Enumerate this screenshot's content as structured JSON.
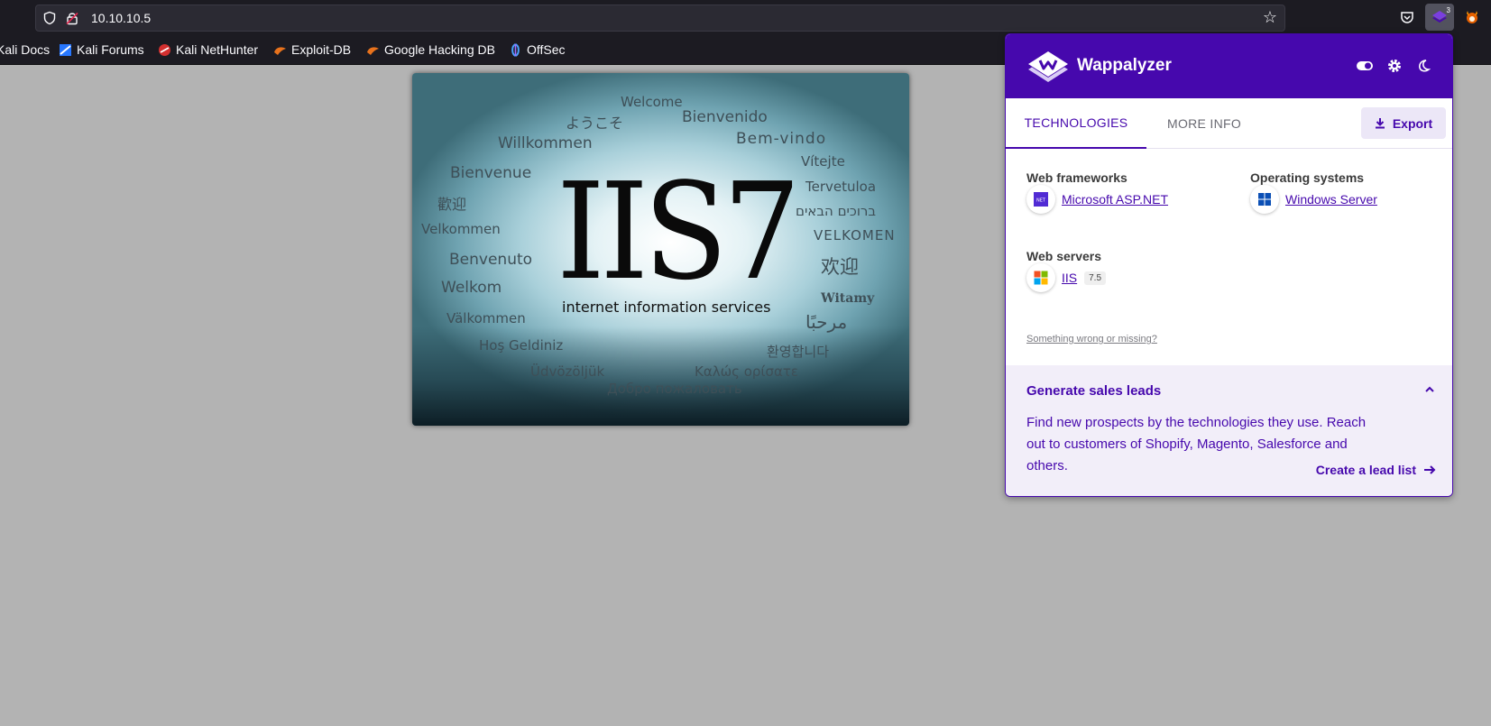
{
  "browser": {
    "url": "10.10.10.5",
    "extension_badge": "3",
    "bookmarks": [
      {
        "label": "Kali Docs",
        "icon": "kali-dragon-icon"
      },
      {
        "label": "Kali Forums",
        "icon": "kali-forums-icon"
      },
      {
        "label": "Kali NetHunter",
        "icon": "nethunter-icon"
      },
      {
        "label": "Exploit-DB",
        "icon": "exploit-db-icon"
      },
      {
        "label": "Google Hacking DB",
        "icon": "ghdb-icon"
      },
      {
        "label": "OffSec",
        "icon": "offsec-icon"
      }
    ]
  },
  "page": {
    "title_text": "IIS7",
    "subtitle": "internet information services",
    "welcome_words": [
      "Welcome",
      "ようこそ",
      "Bienvenido",
      "Willkommen",
      "Bem-vindo",
      "Vítejte",
      "Bienvenue",
      "Tervetuloa",
      "歡迎",
      "ברוכים הבאים",
      "Velkommen",
      "VELKOMEN",
      "Benvenuto",
      "欢迎",
      "Welkom",
      "Witamy",
      "Välkommen",
      "مرحبًا",
      "Hoş Geldiniz",
      "환영합니다",
      "Üdvözöljük",
      "Καλώς ορίσατε",
      "Добро пожаловать"
    ]
  },
  "wappalyzer": {
    "title": "Wappalyzer",
    "tabs": {
      "technologies": "TECHNOLOGIES",
      "more_info": "MORE INFO"
    },
    "export_label": "Export",
    "categories": {
      "web_frameworks": {
        "label": "Web frameworks",
        "tech": "Microsoft ASP.NET"
      },
      "operating_systems": {
        "label": "Operating systems",
        "tech": "Windows Server"
      },
      "web_servers": {
        "label": "Web servers",
        "tech": "IIS",
        "version": "7.5"
      }
    },
    "feedback_link": "Something wrong or missing?",
    "leads": {
      "title": "Generate sales leads",
      "body": "Find new prospects by the technologies they use. Reach out to customers of Shopify, Magento, Salesforce and others.",
      "link": "Create a lead list"
    },
    "accent_color": "#4608ad"
  }
}
